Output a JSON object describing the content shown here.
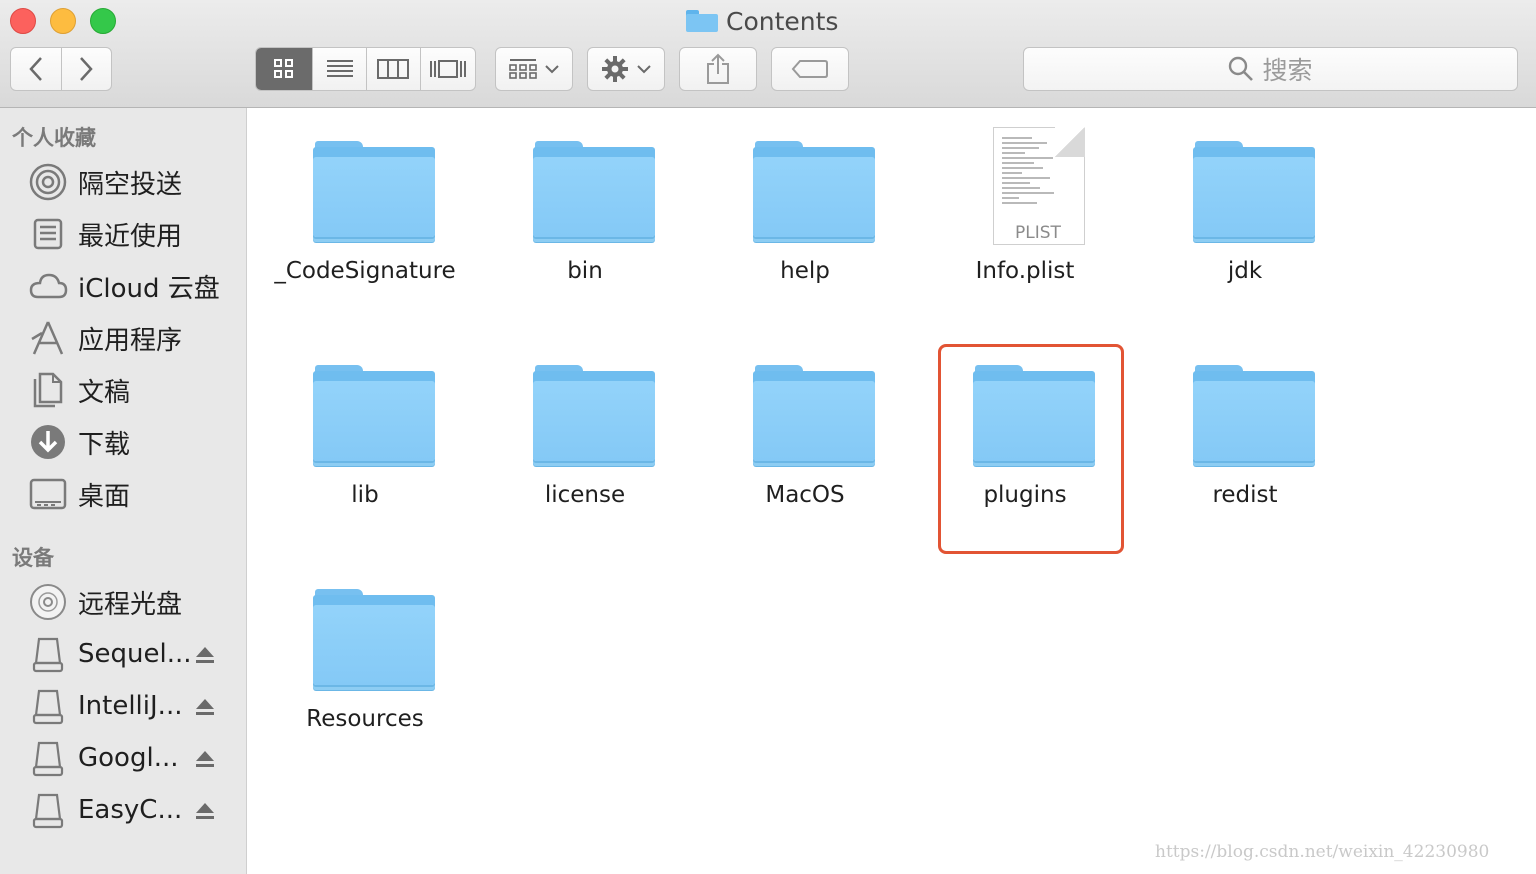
{
  "window": {
    "title": "Contents",
    "title_icon": "folder-icon"
  },
  "toolbar": {
    "back_icon": "chevron-left-icon",
    "forward_icon": "chevron-right-icon",
    "view_modes": [
      "icon-view",
      "list-view",
      "column-view",
      "cover-flow-view"
    ],
    "active_view": "icon-view",
    "group_icon": "group-grid-icon",
    "action_icon": "gear-icon",
    "share_icon": "share-icon",
    "tag_icon": "tag-icon",
    "search_placeholder": "搜索"
  },
  "sidebar": {
    "favorites_header": "个人收藏",
    "favorites": [
      {
        "label": "隔空投送",
        "icon": "airdrop-icon"
      },
      {
        "label": "最近使用",
        "icon": "recents-icon"
      },
      {
        "label": "iCloud 云盘",
        "icon": "cloud-icon"
      },
      {
        "label": "应用程序",
        "icon": "applications-icon"
      },
      {
        "label": "文稿",
        "icon": "documents-icon"
      },
      {
        "label": "下载",
        "icon": "downloads-icon"
      },
      {
        "label": "桌面",
        "icon": "desktop-icon"
      }
    ],
    "devices_header": "设备",
    "devices": [
      {
        "label": "远程光盘",
        "icon": "optical-disc-icon",
        "eject": false
      },
      {
        "label": "Sequel...",
        "icon": "disk-icon",
        "eject": true
      },
      {
        "label": "IntelliJ...",
        "icon": "disk-icon",
        "eject": true
      },
      {
        "label": "Googl...",
        "icon": "disk-icon",
        "eject": true
      },
      {
        "label": "EasyC...",
        "icon": "disk-icon",
        "eject": true
      }
    ]
  },
  "files": [
    {
      "name": "_CodeSignature",
      "kind": "folder"
    },
    {
      "name": "bin",
      "kind": "folder"
    },
    {
      "name": "help",
      "kind": "folder"
    },
    {
      "name": "Info.plist",
      "kind": "plist",
      "badge": "PLIST"
    },
    {
      "name": "jdk",
      "kind": "folder"
    },
    {
      "name": "lib",
      "kind": "folder"
    },
    {
      "name": "license",
      "kind": "folder"
    },
    {
      "name": "MacOS",
      "kind": "folder"
    },
    {
      "name": "plugins",
      "kind": "folder",
      "highlighted": true
    },
    {
      "name": "redist",
      "kind": "folder"
    },
    {
      "name": "Resources",
      "kind": "folder"
    }
  ],
  "colors": {
    "highlight": "#e25434",
    "folder": "#84c9f6",
    "sidebar_bg": "#e8e8e8"
  },
  "watermark": "https://blog.csdn.net/weixin_42230980"
}
